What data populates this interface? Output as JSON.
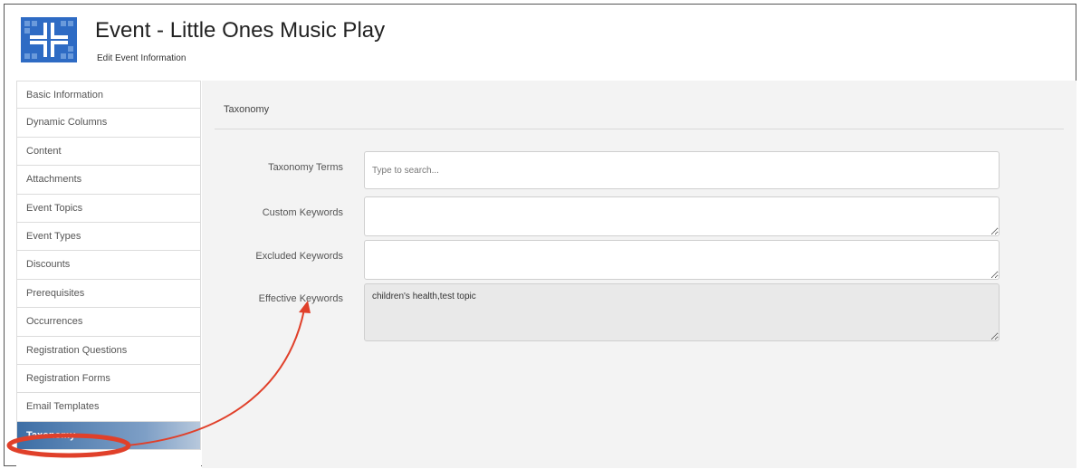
{
  "header": {
    "title": "Event - Little Ones Music Play",
    "subtitle": "Edit Event Information",
    "logo_color": "#2e6bc4"
  },
  "sidebar": {
    "items": [
      {
        "label": "Basic Information"
      },
      {
        "label": "Dynamic Columns"
      },
      {
        "label": "Content"
      },
      {
        "label": "Attachments"
      },
      {
        "label": "Event Topics"
      },
      {
        "label": "Event Types"
      },
      {
        "label": "Discounts"
      },
      {
        "label": "Prerequisites"
      },
      {
        "label": "Occurrences"
      },
      {
        "label": "Registration Questions"
      },
      {
        "label": "Registration Forms"
      },
      {
        "label": "Email Templates"
      },
      {
        "label": "Taxonomy",
        "active": true
      }
    ]
  },
  "main": {
    "section_title": "Taxonomy",
    "fields": {
      "taxonomy_terms": {
        "label": "Taxonomy Terms",
        "placeholder": "Type to search...",
        "value": ""
      },
      "custom_keywords": {
        "label": "Custom Keywords",
        "value": ""
      },
      "excluded_keywords": {
        "label": "Excluded Keywords",
        "value": ""
      },
      "effective_keywords": {
        "label": "Effective Keywords",
        "value": "children's health,test topic"
      }
    }
  },
  "annotation": {
    "color": "#e0402a"
  }
}
